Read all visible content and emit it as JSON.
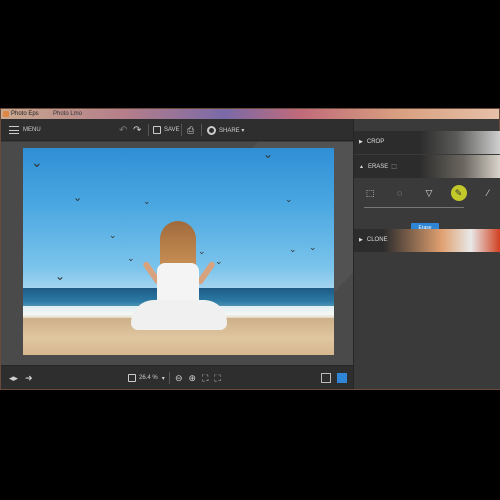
{
  "window": {
    "title": "Photo Eps",
    "title2": "Photo Lmo"
  },
  "toolbar": {
    "menu_label": "MENU",
    "undo_icon": "↶",
    "redo_icon": "↷",
    "save_label": "SAVE",
    "print_icon": "⎙",
    "share_label": "SHARE ▾"
  },
  "statusbar": {
    "back_icon": "◂▸",
    "forward_icon": "➜",
    "zoom_value": "26.4 %",
    "zoom_caret": "▾",
    "zoom_out_icon": "⊖",
    "zoom_in_icon": "⊕",
    "fit_icon": "⛶",
    "actual_icon": "⛶"
  },
  "panel": {
    "crop_label": "CROP",
    "erase_label": "ERASE",
    "erase_tools": [
      "⬚",
      "◌",
      "▽",
      "✎",
      "⁄"
    ],
    "erase_button": "Erase",
    "clone_label": "CLONE",
    "section_caret": "▶",
    "erase_caret": "▲"
  },
  "colors": {
    "accent": "#2f86d6",
    "tool_active": "#c3c82a"
  },
  "gull_icon": "⌄"
}
